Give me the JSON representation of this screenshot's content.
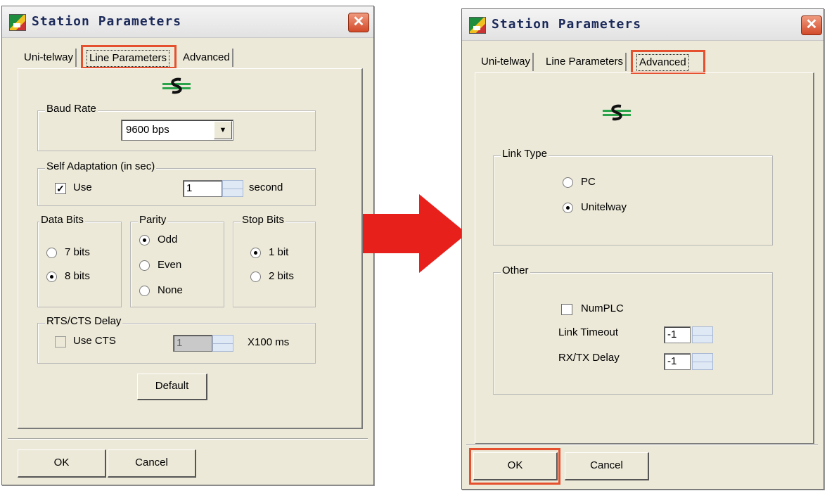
{
  "dialog_left": {
    "title": "Station Parameters",
    "close_glyph": "✕",
    "tabs": [
      "Uni-telway",
      "Line Parameters",
      "Advanced"
    ],
    "active_tab": "Line Parameters",
    "baud_rate": {
      "label": "Baud Rate",
      "value": "9600  bps"
    },
    "self_adaptation": {
      "label": "Self Adaptation (in sec)",
      "use_label": "Use",
      "use_checked": true,
      "value": "1",
      "unit": "second"
    },
    "data_bits": {
      "label": "Data Bits",
      "options": [
        "7 bits",
        "8 bits"
      ],
      "selected": "8 bits"
    },
    "parity": {
      "label": "Parity",
      "options": [
        "Odd",
        "Even",
        "None"
      ],
      "selected": "Odd"
    },
    "stop_bits": {
      "label": "Stop Bits",
      "options": [
        "1 bit",
        "2 bits"
      ],
      "selected": "1 bit"
    },
    "rts_cts": {
      "label": "RTS/CTS Delay",
      "use_label": "Use CTS",
      "use_checked": false,
      "value": "1",
      "unit": "X100 ms"
    },
    "default_button": "Default",
    "ok_button": "OK",
    "cancel_button": "Cancel"
  },
  "dialog_right": {
    "title": "Station Parameters",
    "close_glyph": "✕",
    "tabs": [
      "Uni-telway",
      "Line Parameters",
      "Advanced"
    ],
    "active_tab": "Advanced",
    "link_type": {
      "label": "Link Type",
      "options": [
        "PC",
        "Unitelway"
      ],
      "selected": "Unitelway"
    },
    "other": {
      "label": "Other",
      "numplc_label": "NumPLC",
      "numplc_checked": false,
      "link_timeout_label": "Link Timeout",
      "link_timeout_value": "-1",
      "rxtx_delay_label": "RX/TX Delay",
      "rxtx_delay_value": "-1"
    },
    "ok_button": "OK",
    "cancel_button": "Cancel"
  },
  "colors": {
    "highlight": "#e5502e",
    "arrow": "#e8201c",
    "dialog_bg": "#ece9d8",
    "close": "#d24a2a"
  },
  "icons": [
    "station-icon",
    "network-s-icon",
    "close-icon",
    "arrow-right-icon"
  ]
}
